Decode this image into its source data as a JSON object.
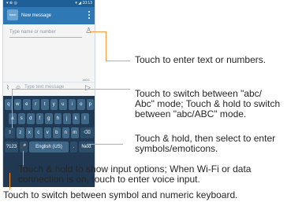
{
  "phone": {
    "status_left": "▾ ⊕ ◎",
    "status_right": "▾ ◢ 10:13",
    "back_label": "back",
    "title": "New message",
    "to_placeholder": "Type name or number",
    "message_placeholder": "Type text message",
    "char_count": "160/1",
    "keyboard": {
      "row1": [
        "q",
        "w",
        "e",
        "r",
        "t",
        "y",
        "u",
        "i",
        "o",
        "p"
      ],
      "row2": [
        "a",
        "s",
        "d",
        "f",
        "g",
        "h",
        "j",
        "k",
        "l"
      ],
      "row3": [
        "⇧",
        "z",
        "x",
        "c",
        "v",
        "b",
        "n",
        "m",
        "⌫"
      ],
      "row4": [
        "?123",
        "🎤",
        "English (US)",
        ".",
        "Next"
      ]
    }
  },
  "callouts": {
    "enter_text": "Touch to enter text or numbers.",
    "switch_abc_1": "Touch to switch  between \"abc/",
    "switch_abc_2": "Abc\" mode; Touch & hold to switch",
    "switch_abc_3": "between \"abc/ABC\" mode.",
    "symbols_1": "Touch & hold, then select to enter",
    "symbols_2": "symbols/emoticons.",
    "input_options_1": "Touch & hold to show input options;  When Wi-Fi or data",
    "input_options_2": "connection is on, touch to enter voice input.",
    "numeric_kb": "Touch to switch between symbol and numeric keyboard."
  },
  "colors": {
    "callout_line": "#ff9a3c",
    "keyboard_bg": "#203852",
    "action_bar": "#2d78b5"
  }
}
